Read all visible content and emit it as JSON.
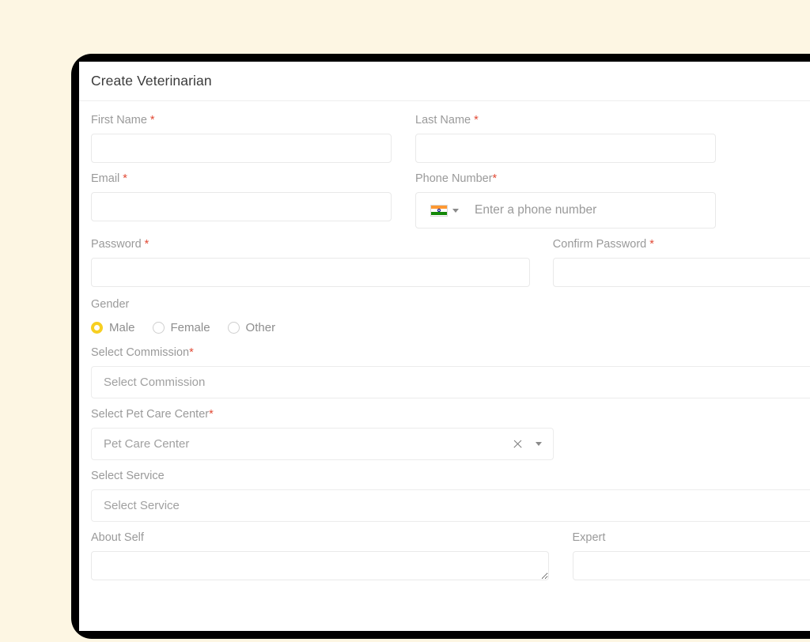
{
  "page": {
    "background_color": "#fdf6e3",
    "frame_color": "#000000"
  },
  "header": {
    "title": "Create Veterinarian"
  },
  "form": {
    "first_name": {
      "label": "First Name",
      "required_marker": "*",
      "value": "",
      "placeholder": ""
    },
    "last_name": {
      "label": "Last Name",
      "required_marker": "*",
      "value": "",
      "placeholder": ""
    },
    "email": {
      "label": "Email",
      "required_marker": "*",
      "value": "",
      "placeholder": ""
    },
    "phone": {
      "label": "Phone Number",
      "required_marker": "*",
      "country_flag": "india-flag-icon",
      "value": "",
      "placeholder": "Enter a phone number"
    },
    "password": {
      "label": "Password",
      "required_marker": "*",
      "value": "",
      "placeholder": ""
    },
    "confirm_password": {
      "label": "Confirm Password",
      "required_marker": "*",
      "value": "",
      "placeholder": ""
    },
    "gender": {
      "label": "Gender",
      "selected": "Male",
      "accent_color": "#f7cf21",
      "options": [
        {
          "label": "Male",
          "checked": true
        },
        {
          "label": "Female",
          "checked": false
        },
        {
          "label": "Other",
          "checked": false
        }
      ]
    },
    "commission": {
      "label": "Select Commission",
      "required_marker": "*",
      "value": "",
      "placeholder": "Select Commission"
    },
    "pet_care_center": {
      "label": "Select Pet Care Center",
      "required_marker": "*",
      "value": "",
      "placeholder": "Pet Care Center",
      "clear_icon": "close-icon",
      "dropdown_icon": "chevron-down-icon"
    },
    "service": {
      "label": "Select Service",
      "value": "",
      "placeholder": "Select Service"
    },
    "about_self": {
      "label": "About Self",
      "value": "",
      "placeholder": ""
    },
    "expert": {
      "label": "Expert",
      "value": "",
      "placeholder": ""
    }
  }
}
